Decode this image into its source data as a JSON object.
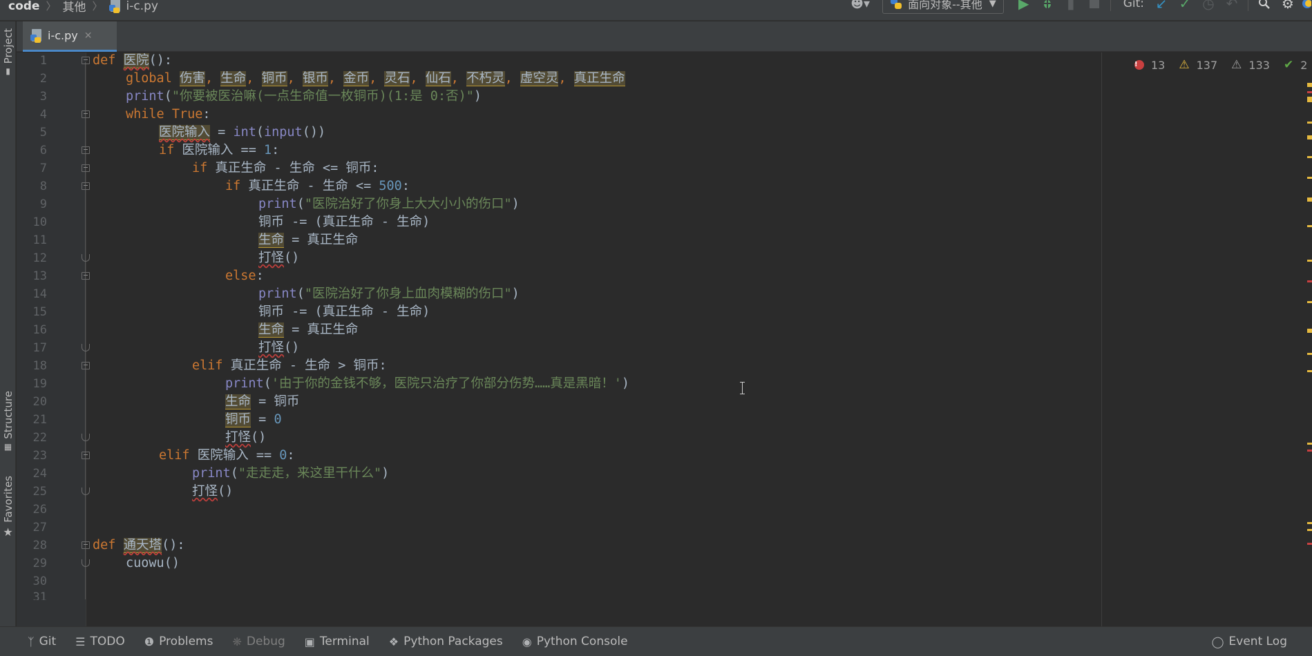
{
  "breadcrumb": {
    "root": "code",
    "folder": "其他",
    "file": "i-c.py"
  },
  "toolbar": {
    "run_config": "面向对象--其他",
    "git_label": "Git:"
  },
  "left_tools": {
    "project": "Project",
    "structure": "Structure",
    "favorites": "Favorites"
  },
  "editor_tab": {
    "label": "i-c.py"
  },
  "inspections": {
    "errors": "13",
    "warnings": "137",
    "weak_warnings": "133",
    "typos": "2"
  },
  "line_numbers": [
    "1",
    "2",
    "3",
    "4",
    "5",
    "6",
    "7",
    "8",
    "9",
    "10",
    "11",
    "12",
    "13",
    "14",
    "15",
    "16",
    "17",
    "18",
    "19",
    "20",
    "21",
    "22",
    "23",
    "24",
    "25",
    "26",
    "27",
    "28",
    "29",
    "30",
    "31"
  ],
  "code": {
    "l1_def": "def ",
    "l1_name": "医院",
    "l1_rest": "():",
    "l2_kw": "global ",
    "l2_v1": "伤害",
    "l2_v2": "生命",
    "l2_v3": "铜币",
    "l2_v4": "银币",
    "l2_v5": "金币",
    "l2_v6": "灵石",
    "l2_v7": "仙石",
    "l2_v8": "不朽灵",
    "l2_v9": "虚空灵",
    "l2_v10": "真正生命",
    "comma": ", ",
    "print": "print",
    "open_paren": "(",
    "close_paren": ")",
    "l3_str": "\"你要被医治嘛(一点生命值一枚铜币)(1:是 0:否)\"",
    "l4_kw": "while ",
    "l4_true": "True",
    "colon": ":",
    "l5_var": "医院输入",
    "l5_eq": " = ",
    "l5_int": "int",
    "l5_input": "input",
    "l5_rest": "())",
    "l6_kw": "if ",
    "l6_rest": "医院输入 == ",
    "l6_num": "1",
    "l7_kw": "if ",
    "l7_rest": "真正生命 - 生命 <= 铜币:",
    "l8_kw": "if ",
    "l8_rest": "真正生命 - 生命 <= ",
    "l8_num": "500",
    "l9_str": "\"医院治好了你身上大大小小的伤口\"",
    "l10": "铜币 -= (真正生命 - 生命)",
    "l11_var": "生命",
    "l11_rest": " = 真正生命",
    "l12_fn": "打怪",
    "l12_rest": "()",
    "l13_kw": "else",
    "l14_str": "\"医院治好了你身上血肉模糊的伤口\"",
    "l15": "铜币 -= (真正生命 - 生命)",
    "l16_var": "生命",
    "l16_rest": " = 真正生命",
    "l17_fn": "打怪",
    "l17_rest": "()",
    "l18_kw": "elif ",
    "l18_rest": "真正生命 - 生命 > 铜币:",
    "l19_str": "'由于你的金钱不够，医院只治疗了你部分伤势……真是黑暗！'",
    "l20_var": "生命",
    "l20_rest": " = 铜币",
    "l21_var": "铜币",
    "l21_eq": " = ",
    "l21_num": "0",
    "l22_fn": "打怪",
    "l22_rest": "()",
    "l23_kw": "elif ",
    "l23_rest": "医院输入 == ",
    "l23_num": "0",
    "l24_str": "\"走走走，来这里干什么\"",
    "l25_fn": "打怪",
    "l25_rest": "()",
    "l28_def": "def ",
    "l28_name": "通天塔",
    "l28_rest": "():",
    "l29": "cuowu()"
  },
  "bottom_tools": {
    "git": "Git",
    "todo": "TODO",
    "problems": "Problems",
    "debug": "Debug",
    "terminal": "Terminal",
    "python_packages": "Python Packages",
    "python_console": "Python Console",
    "event_log": "Event Log"
  },
  "colors": {
    "editor_bg": "#2b2b2b",
    "keyword": "#cc7832",
    "string": "#6a8759",
    "number": "#6897bb",
    "builtin": "#8888c6",
    "accent": "#4a88c7"
  }
}
